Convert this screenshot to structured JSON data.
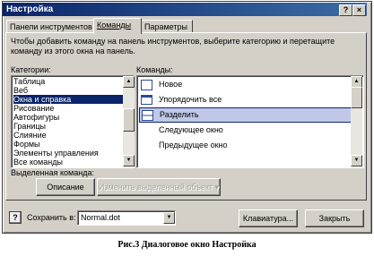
{
  "window": {
    "title": "Настройка",
    "help_glyph": "?",
    "close_glyph": "×"
  },
  "tabs": [
    {
      "label": "Панели инструментов",
      "active": false
    },
    {
      "label": "Команды",
      "active": true
    },
    {
      "label": "Параметры",
      "active": false
    }
  ],
  "instruction": "Чтобы добавить команду на панель инструментов, выберите категорию и перетащите команду из этого окна на панель.",
  "categories": {
    "label": "Категории:",
    "items": [
      "Таблица",
      "Веб",
      "Окна и справка",
      "Рисование",
      "Автофигуры",
      "Границы",
      "Слияние",
      "Формы",
      "Элементы управления",
      "Все команды"
    ],
    "selected": "Окна и справка"
  },
  "commands": {
    "label": "Команды:",
    "items": [
      {
        "label": "Новое",
        "icon": "new-window-icon"
      },
      {
        "label": "Упорядочить все",
        "icon": "arrange-icon"
      },
      {
        "label": "Разделить",
        "icon": "split-icon"
      },
      {
        "label": "Следующее окно",
        "icon": ""
      },
      {
        "label": "Предыдущее окно",
        "icon": ""
      }
    ],
    "selected": "Разделить"
  },
  "selected_command": {
    "label": "Выделенная команда:",
    "description_button": "Описание",
    "modify_button": "Изменить выделенный объект"
  },
  "footer": {
    "save_in_label": "Сохранить в:",
    "save_in_value": "Normal.dot",
    "keyboard_button": "Клавиатура...",
    "close_button": "Закрыть"
  },
  "caption": "Рис.3 Диалоговое окно Настройка",
  "colors": {
    "title_bar": "#0a246a",
    "selection": "#0a246a",
    "face": "#d4d0c8",
    "command_highlight": "#c0c8e8"
  }
}
